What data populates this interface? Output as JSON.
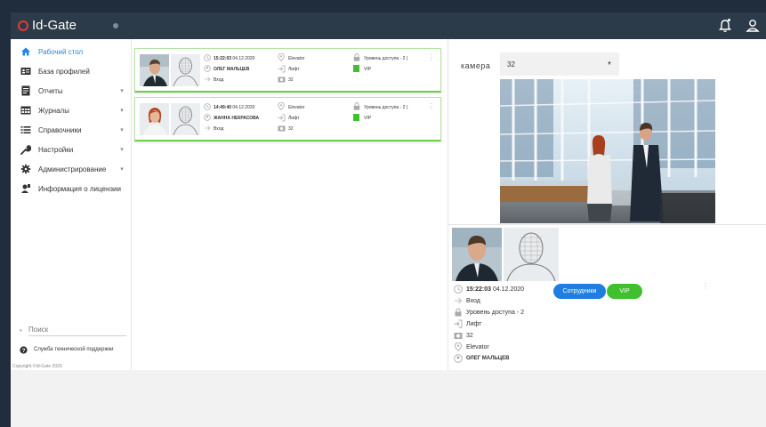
{
  "app": {
    "title": "Id-Gate"
  },
  "sidebar": {
    "items": [
      {
        "label": "Рабочий стол",
        "icon": "home-icon",
        "active": true,
        "chevron": false
      },
      {
        "label": "База профилей",
        "icon": "id-card-icon",
        "active": false,
        "chevron": false
      },
      {
        "label": "Отчеты",
        "icon": "report-icon",
        "active": false,
        "chevron": true
      },
      {
        "label": "Журналы",
        "icon": "table-icon",
        "active": false,
        "chevron": true
      },
      {
        "label": "Справочники",
        "icon": "list-icon",
        "active": false,
        "chevron": true
      },
      {
        "label": "Настройки",
        "icon": "wrench-icon",
        "active": false,
        "chevron": true
      },
      {
        "label": "Администрирование",
        "icon": "gear-icon",
        "active": false,
        "chevron": true
      },
      {
        "label": "Информация о лицензии",
        "icon": "user-license-icon",
        "active": false,
        "chevron": false
      }
    ],
    "search_placeholder": "Поиск",
    "support_label": "Служба технической поддержки",
    "copyright": "Copyright ©Id-Gate 2020"
  },
  "events": [
    {
      "time": "15:22:03",
      "date": "04.12.2020",
      "name": "ОЛЕГ МАЛЬЦЕВ",
      "direction": "Вход",
      "location": "Elevator",
      "zone": "Лифт",
      "camera": "32",
      "access": "Уровень доступа - 2 (",
      "group": "VIP",
      "person": "man"
    },
    {
      "time": "14:49:40",
      "date": "04.12.2020",
      "name": "ЖАННА НЕКРАСОВА",
      "direction": "Вход",
      "location": "Elevator",
      "zone": "Лифт",
      "camera": "32",
      "access": "Уровень доступа - 2 (",
      "group": "VIP",
      "person": "woman"
    }
  ],
  "camera": {
    "label": "камера",
    "selected": "32"
  },
  "detail": {
    "time": "15:22:03",
    "date": "04.12.2020",
    "tag_staff": "Сотрудники",
    "tag_vip": "VIP",
    "direction": "Вход",
    "access": "Уровень доступа - 2",
    "zone": "Лифт",
    "camera": "32",
    "location": "Elevator",
    "name": "ОЛЕГ МАЛЬЦЕВ"
  },
  "colors": {
    "topbar": "#2c3b49",
    "accent": "#1e88e5",
    "card_border": "#6fcf4a",
    "vip_green": "#3ec12c",
    "staff_blue": "#1f7fe0",
    "brand_red": "#e53935"
  }
}
